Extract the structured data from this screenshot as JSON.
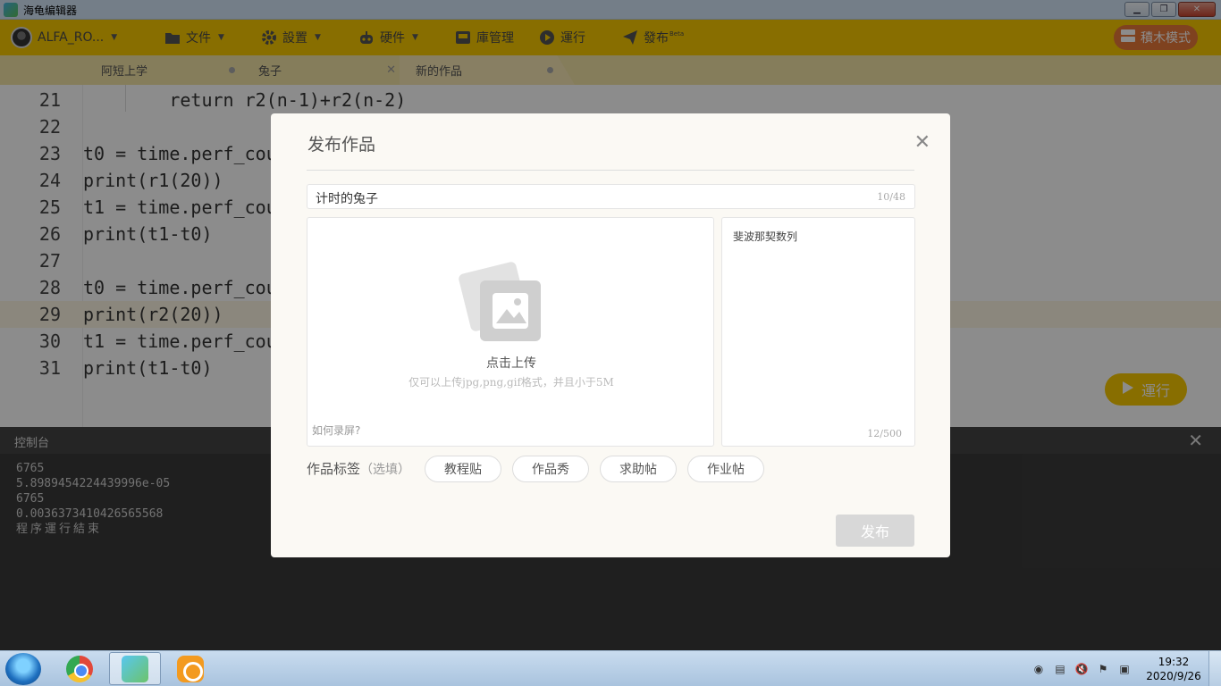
{
  "window": {
    "title": "海龟编辑器"
  },
  "toolbar": {
    "user": "ALFA_RO...",
    "file": "文件",
    "settings": "設置",
    "hardware": "硬件",
    "library": "庫管理",
    "run": "運行",
    "publish": "發布",
    "publish_badge": "Beta",
    "block_mode": "積木模式"
  },
  "tabs": [
    {
      "label": "阿短上学"
    },
    {
      "label": "兔子"
    },
    {
      "label": "新的作品"
    }
  ],
  "editor": {
    "lines": [
      {
        "num": "21",
        "code": "        return r2(n-1)+r2(n-2)"
      },
      {
        "num": "22",
        "code": ""
      },
      {
        "num": "23",
        "code": "t0 = time.perf_cou"
      },
      {
        "num": "24",
        "code": "print(r1(20))"
      },
      {
        "num": "25",
        "code": "t1 = time.perf_cou"
      },
      {
        "num": "26",
        "code": "print(t1-t0)"
      },
      {
        "num": "27",
        "code": ""
      },
      {
        "num": "28",
        "code": "t0 = time.perf_cou"
      },
      {
        "num": "29",
        "code": "print(r2(20))"
      },
      {
        "num": "30",
        "code": "t1 = time.perf_cou"
      },
      {
        "num": "31",
        "code": "print(t1-t0)"
      }
    ],
    "run_button": "運行"
  },
  "console": {
    "title": "控制台",
    "lines": [
      "6765",
      "5.8989454224439996e-05",
      "6765",
      "0.0036373410426565568",
      "程序運行結束"
    ]
  },
  "modal": {
    "title": "发布作品",
    "name_value": "计时的兔子",
    "name_count": "10/48",
    "upload_title": "点击上传",
    "upload_hint": "仅可以上传jpg,png,gif格式，并且小于5M",
    "how_record": "如何录屏?",
    "description": "斐波那契数列",
    "desc_count": "12/500",
    "tags_label": "作品标签",
    "tags_optional": "（选填）",
    "tags": [
      "教程贴",
      "作品秀",
      "求助帖",
      "作业帖"
    ],
    "publish_button": "发布"
  },
  "taskbar": {
    "time": "19:32",
    "date": "2020/9/26"
  }
}
